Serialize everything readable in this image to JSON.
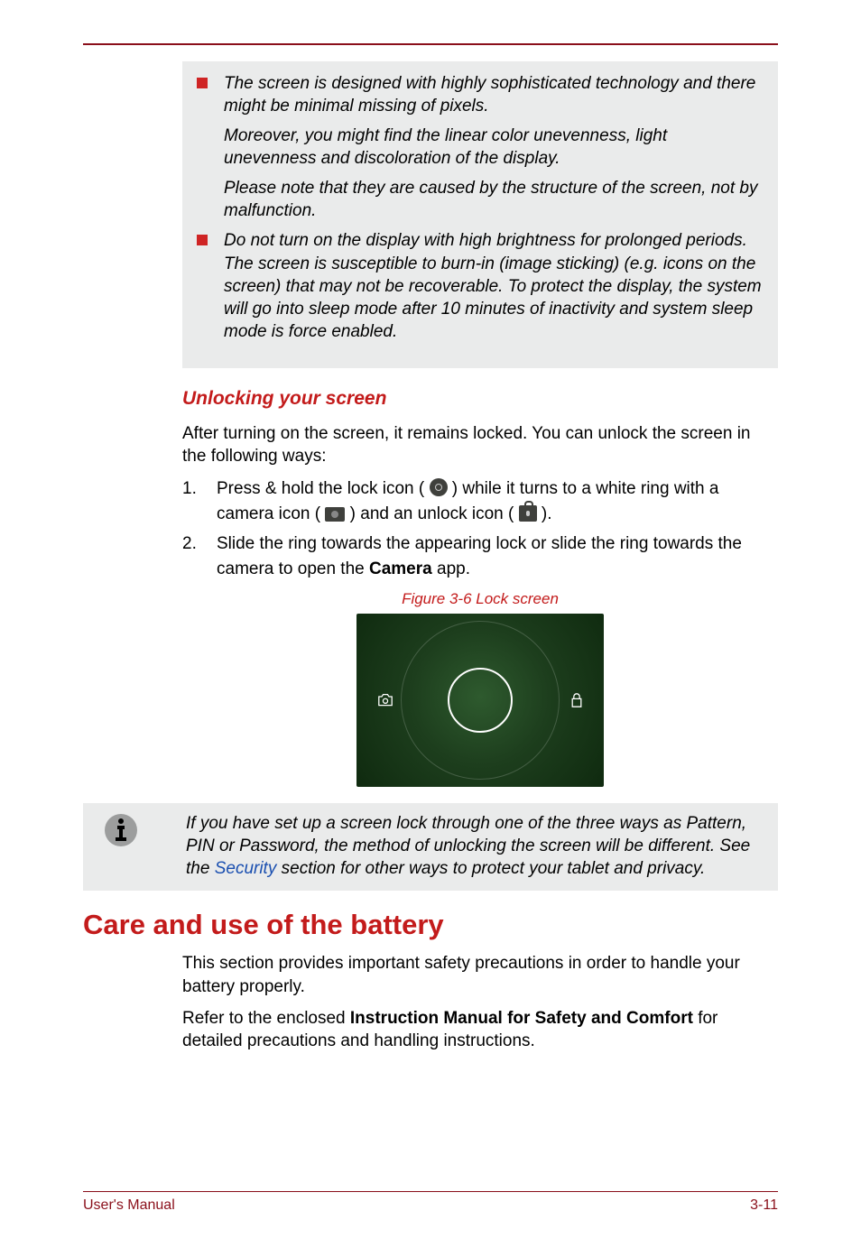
{
  "callout1": {
    "bullet1_p1": "The screen is designed with highly sophisticated technology and there might be minimal missing of pixels.",
    "bullet1_p2": "Moreover, you might find the linear color unevenness, light unevenness and discoloration of the display.",
    "bullet1_p3": "Please note that they are caused by the structure of the screen, not by malfunction.",
    "bullet2": "Do not turn on the display with high brightness for prolonged periods. The screen is susceptible to burn-in (image sticking) (e.g. icons on the screen) that may not be recoverable. To protect the display, the system will go into sleep mode after 10 minutes of inactivity and system sleep mode is force enabled."
  },
  "section_unlock": {
    "heading": "Unlocking your screen",
    "intro": "After turning on the screen, it remains locked. You can unlock the screen in the following ways:",
    "steps": {
      "s1_num": "1.",
      "s1_a": "Press & hold the lock icon ( ",
      "s1_b": " ) while it turns to a white ring with a camera icon ( ",
      "s1_c": " ) and an unlock icon ( ",
      "s1_d": " ).",
      "s2_num": "2.",
      "s2_a": "Slide the ring towards the appearing lock or slide the ring towards the camera to open the ",
      "s2_bold": "Camera",
      "s2_b": " app."
    },
    "figure_caption": "Figure 3-6 Lock screen"
  },
  "note": {
    "before_link": "If you have set up a screen lock through one of the three ways as Pattern, PIN or Password, the method of unlocking the screen will be different. See the ",
    "link": "Security",
    "after_link": " section for other ways to protect your tablet and privacy."
  },
  "section_battery": {
    "heading": "Care and use of the battery",
    "p1": "This section provides important safety precautions in order to handle your battery properly.",
    "p2_a": "Refer to the enclosed ",
    "p2_bold": "Instruction Manual for Safety and Comfort",
    "p2_b": " for detailed precautions and handling instructions."
  },
  "footer": {
    "left": "User's Manual",
    "right": "3-11"
  }
}
